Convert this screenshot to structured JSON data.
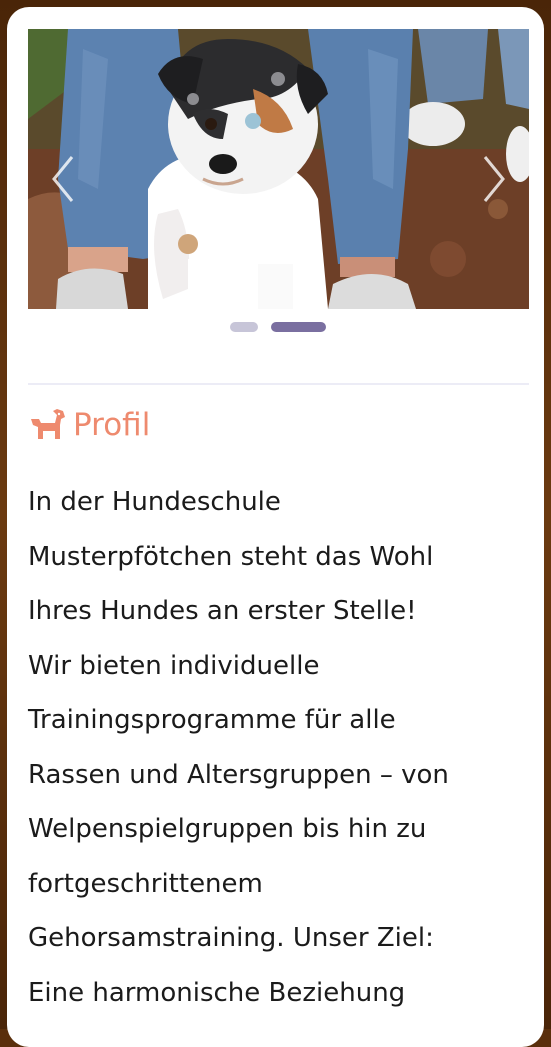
{
  "carousel": {
    "image_alt": "Welpe zwischen Beinen",
    "prev_label": "‹",
    "next_label": "›",
    "slide_count": 2,
    "active_slide": 2
  },
  "profile": {
    "icon": "dog-icon",
    "title": "Profil",
    "lines": [
      "In der Hundeschule",
      "Musterpfötchen steht das Wohl",
      "Ihres Hundes an erster Stelle!",
      "Wir bieten individuelle",
      "Trainingsprogramme für alle",
      "Rassen und Altersgruppen – von",
      "Welpenspielgruppen bis hin zu",
      "fortgeschrittenem",
      "Gehorsamstraining. Unser Ziel:",
      "Eine harmonische Beziehung"
    ]
  },
  "colors": {
    "accent": "#ee8a6e",
    "dot_active": "#7a6fa0",
    "dot_inactive": "#c7c5d8",
    "frame": "#5a2f0c"
  }
}
